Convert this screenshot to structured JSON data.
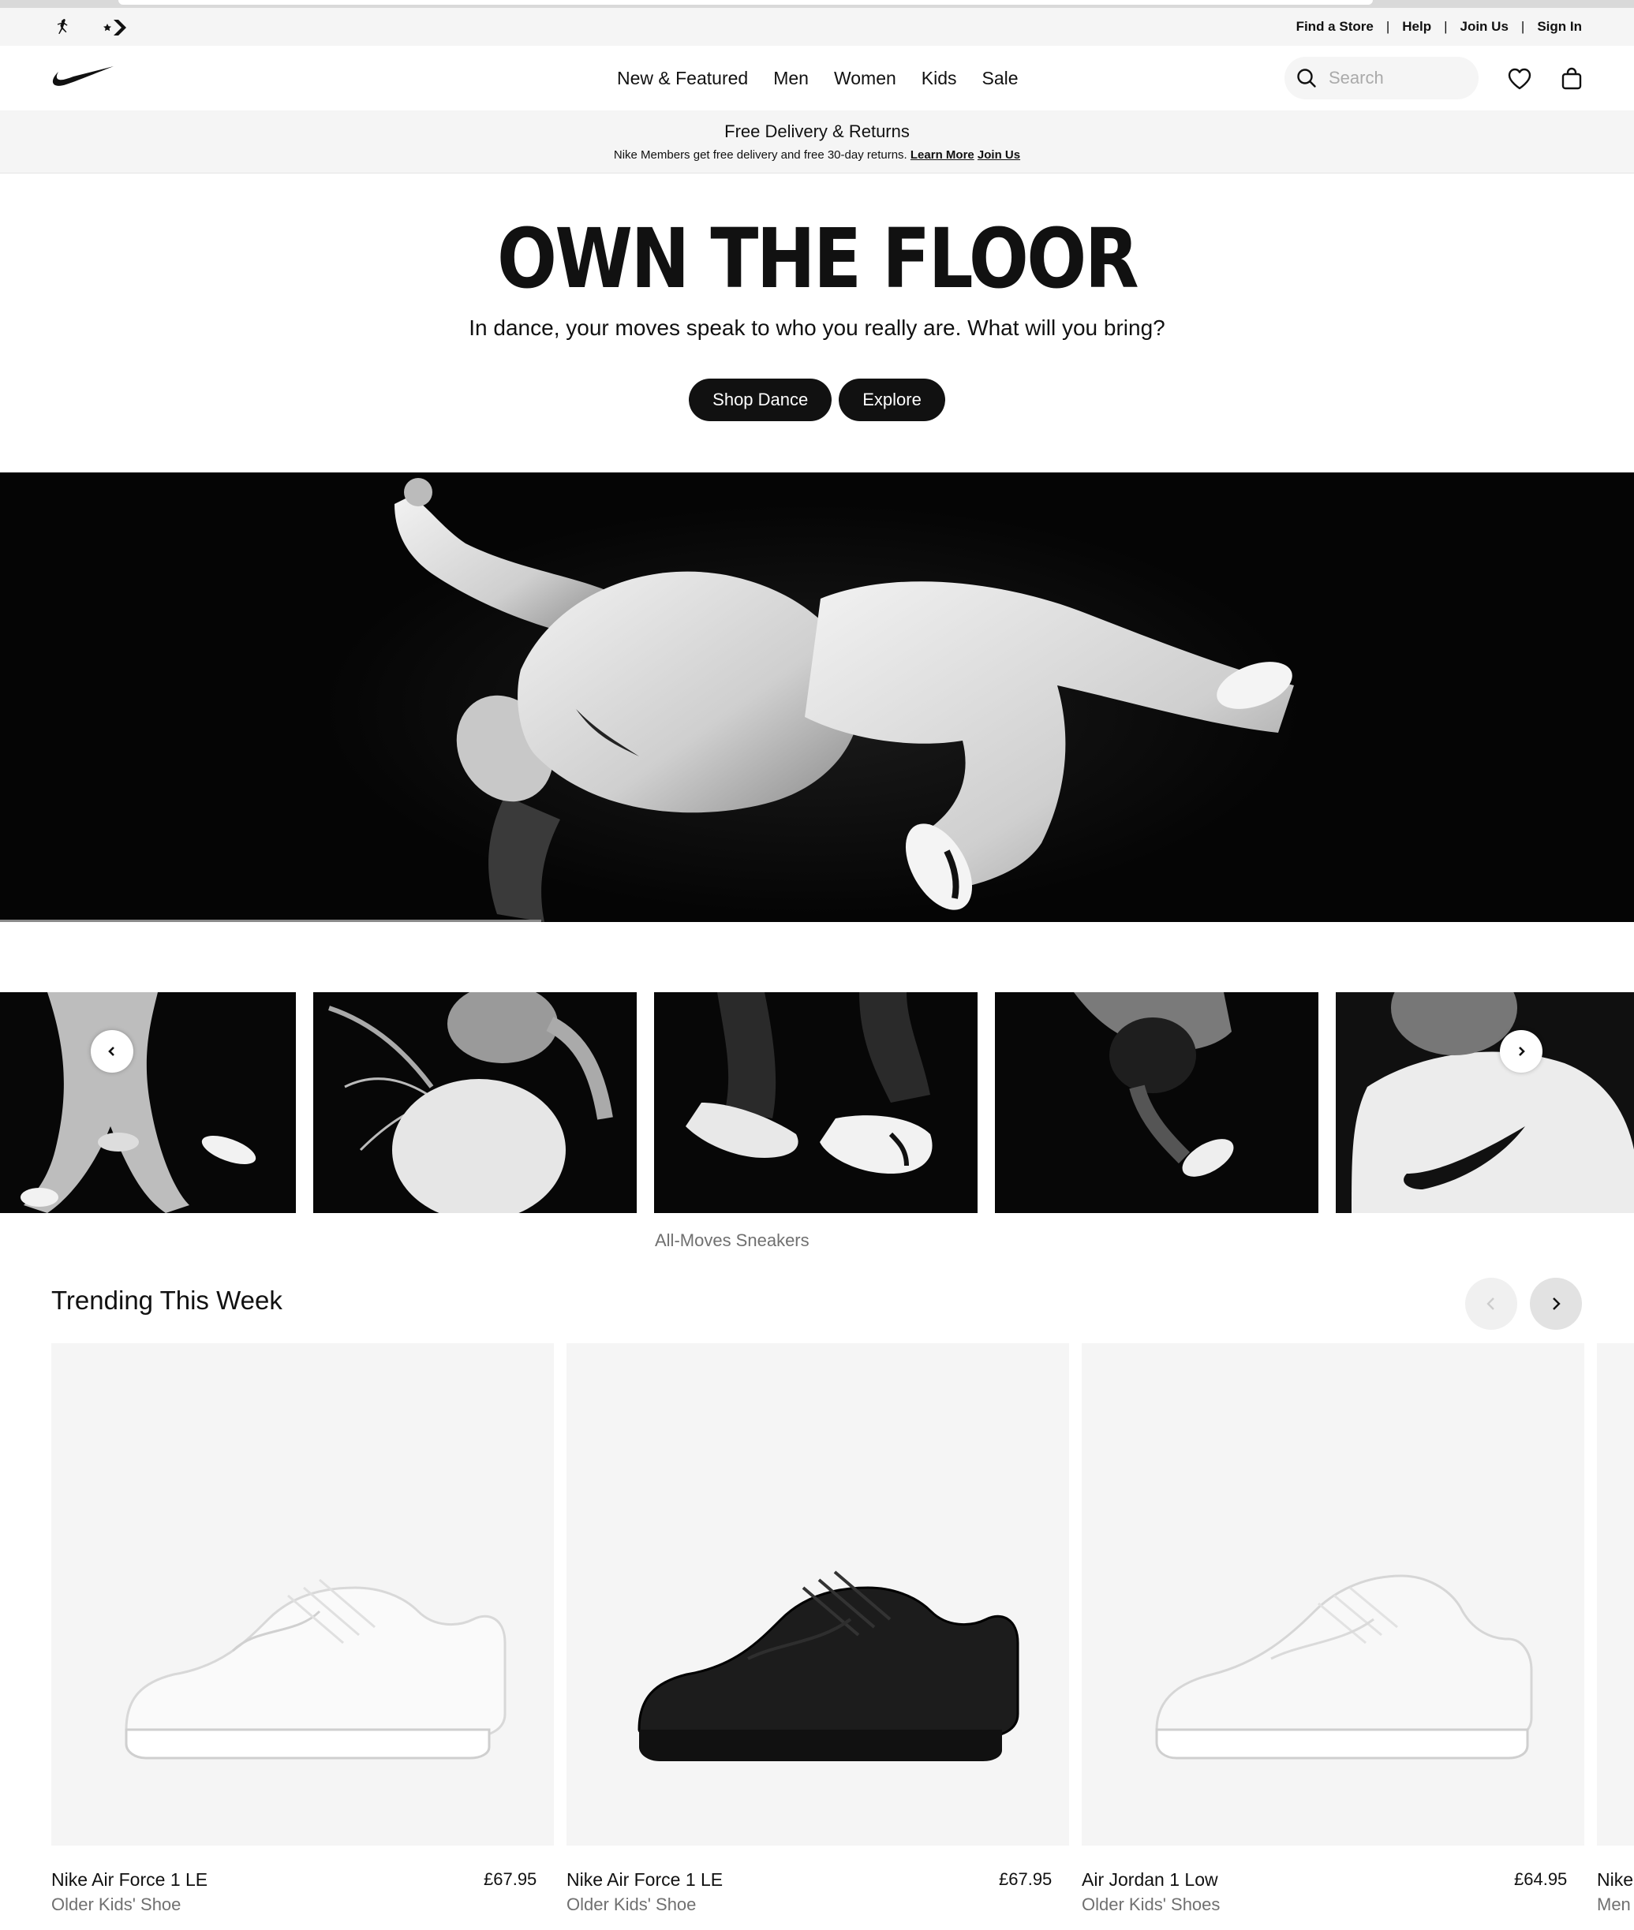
{
  "utility_bar": {
    "links": [
      "Find a Store",
      "Help",
      "Join Us",
      "Sign In"
    ]
  },
  "header": {
    "nav": [
      "New & Featured",
      "Men",
      "Women",
      "Kids",
      "Sale"
    ],
    "search_placeholder": "Search"
  },
  "promo": {
    "title": "Free Delivery & Returns",
    "text": "Nike Members get free delivery and free 30-day returns.",
    "learn_more": "Learn More",
    "join_us": "Join Us"
  },
  "hero": {
    "title": "OWN THE FLOOR",
    "subtitle": "In dance, your moves speak to who you really are. What will you bring?",
    "buttons": [
      "Shop Dance",
      "Explore"
    ]
  },
  "thumbnails": {
    "caption": "All-Moves Sneakers"
  },
  "trending": {
    "title": "Trending This Week",
    "products": [
      {
        "name": "Nike Air Force 1 LE",
        "subtitle": "Older Kids' Shoe",
        "price": "£67.95",
        "color": "white"
      },
      {
        "name": "Nike Air Force 1 LE",
        "subtitle": "Older Kids' Shoe",
        "price": "£67.95",
        "color": "black"
      },
      {
        "name": "Air Jordan 1 Low",
        "subtitle": "Older Kids' Shoes",
        "price": "£64.95",
        "color": "white"
      },
      {
        "name": "Nike",
        "subtitle": "Men",
        "price": "",
        "color": "white"
      }
    ]
  },
  "colors": {
    "accent": "#111111",
    "muted": "#707070",
    "surface": "#f5f5f5"
  }
}
